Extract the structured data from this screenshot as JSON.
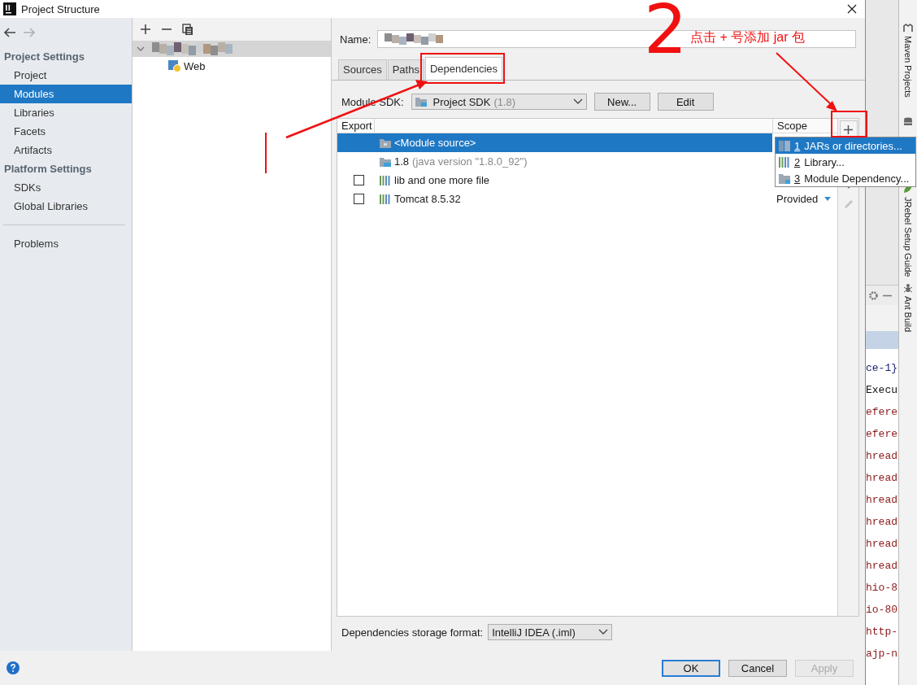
{
  "window": {
    "title": "Project Structure"
  },
  "navigation": [
    {
      "kind": "back",
      "disabled": false
    },
    {
      "kind": "forward",
      "disabled": true
    }
  ],
  "sidebar": {
    "sections": [
      {
        "title": "Project Settings",
        "items": [
          {
            "label": "Project",
            "selected": false
          },
          {
            "label": "Modules",
            "selected": true
          },
          {
            "label": "Libraries",
            "selected": false
          },
          {
            "label": "Facets",
            "selected": false
          },
          {
            "label": "Artifacts",
            "selected": false
          }
        ]
      },
      {
        "title": "Platform Settings",
        "items": [
          {
            "label": "SDKs",
            "selected": false
          },
          {
            "label": "Global Libraries",
            "selected": false
          }
        ]
      }
    ],
    "footer_items": [
      {
        "label": "Problems",
        "selected": false
      }
    ]
  },
  "module_tree": {
    "nodes": [
      {
        "kind": "picture",
        "expanded": true,
        "selected": true,
        "children": [
          {
            "label": "Web",
            "selected": false
          }
        ]
      }
    ]
  },
  "module": {
    "name_label": "Name:",
    "tabs": [
      {
        "label": "Sources",
        "selected": false
      },
      {
        "label": "Paths",
        "selected": false
      },
      {
        "label": "Dependencies",
        "selected": true
      }
    ],
    "sdk": {
      "label": "Module SDK:",
      "value": "Project SDK",
      "hint": "(1.8)"
    },
    "sdk_buttons": [
      "New...",
      "Edit"
    ],
    "table": {
      "columns": [
        "Export",
        "Scope"
      ],
      "rows": [
        {
          "kind": "source",
          "label": "<Module source>",
          "selected": true
        },
        {
          "kind": "sdk",
          "label": "1.8",
          "detail": "(java version \"1.8.0_92\")",
          "selected": false
        },
        {
          "kind": "library",
          "label": "lib and one more file",
          "exported": false,
          "selected": false
        },
        {
          "kind": "library",
          "label": "Tomcat 8.5.32",
          "exported": false,
          "scope": "Provided",
          "selected": false
        }
      ]
    },
    "add_menu": [
      {
        "kind": "jars",
        "number": "1",
        "label": "JARs or directories...",
        "selected": true
      },
      {
        "kind": "library",
        "number": "2",
        "label": "Library...",
        "selected": false
      },
      {
        "kind": "module",
        "number": "3",
        "label": "Module Dependency...",
        "selected": false
      }
    ],
    "storage_format": {
      "label": "Dependencies storage format:",
      "value": "IntelliJ IDEA (.iml)"
    }
  },
  "buttons": [
    {
      "label": "OK",
      "default": true,
      "disabled": false
    },
    {
      "label": "Cancel",
      "default": false,
      "disabled": false
    },
    {
      "label": "Apply",
      "default": false,
      "disabled": true
    }
  ],
  "ide": {
    "tool_windows": [
      {
        "kind": "maven",
        "label": "Maven Projects"
      },
      {
        "kind": "database"
      },
      {
        "kind": "jrebel",
        "label": "JRebel Setup Guide"
      },
      {
        "kind": "ant",
        "label": "Ant Build"
      }
    ],
    "editor_lines": [
      {
        "text": "ce-1}",
        "color": "#1c1c6e"
      },
      {
        "text": "Execu",
        "color": "#111111"
      },
      {
        "text": "efere",
        "color": "#8b1a1a"
      },
      {
        "text": "efere",
        "color": "#8b1a1a"
      },
      {
        "text": "hread",
        "color": "#8b1a1a"
      },
      {
        "text": "hread",
        "color": "#8b1a1a"
      },
      {
        "text": "hread",
        "color": "#8b1a1a"
      },
      {
        "text": "hread",
        "color": "#8b1a1a"
      },
      {
        "text": "hread",
        "color": "#8b1a1a"
      },
      {
        "text": "hread",
        "color": "#8b1a1a"
      },
      {
        "text": "hio-8",
        "color": "#8b1a1a"
      },
      {
        "text": "io-80",
        "color": "#8b1a1a"
      },
      {
        "text": "http-",
        "color": "#8b1a1a"
      },
      {
        "text": "ajp-n",
        "color": "#8b1a1a"
      }
    ]
  },
  "annotations": {
    "step": "2",
    "note": "点击 + 号添加 jar 包"
  }
}
